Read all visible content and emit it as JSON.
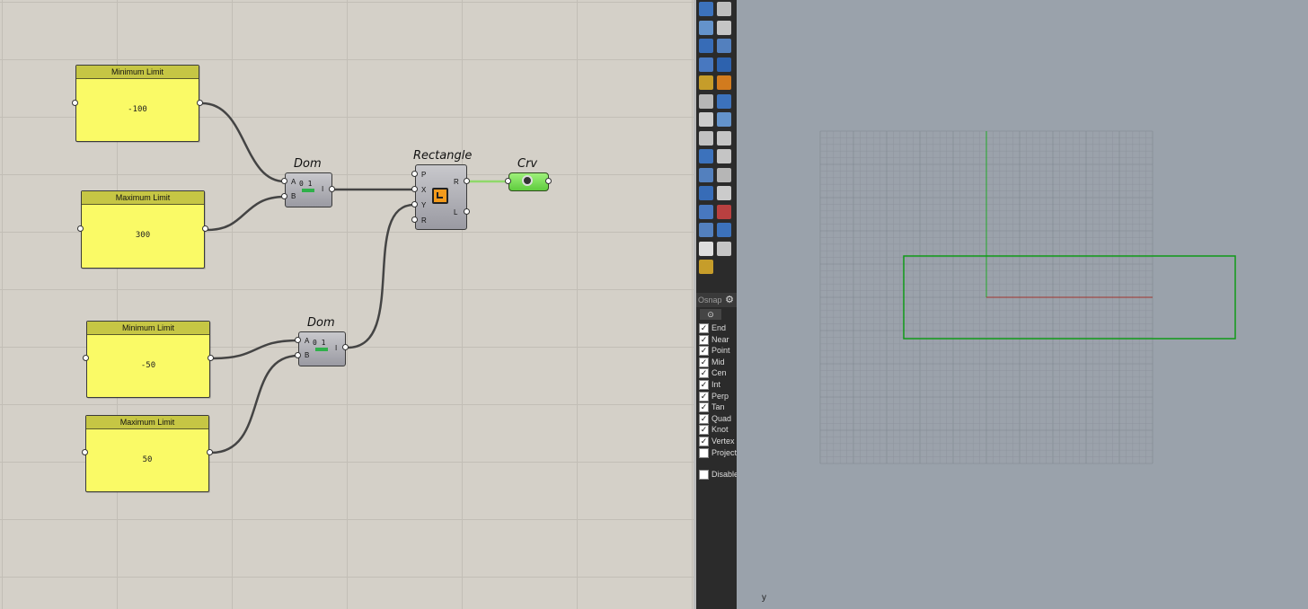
{
  "definition": {
    "sliders": [
      {
        "title": "Minimum Limit",
        "value": "-100"
      },
      {
        "title": "Maximum Limit",
        "value": "300"
      },
      {
        "title": "Minimum Limit",
        "value": "-50"
      },
      {
        "title": "Maximum Limit",
        "value": "50"
      }
    ],
    "dom1": {
      "title": "Dom",
      "inputs": [
        "A",
        "B"
      ],
      "outputs": [
        "I"
      ]
    },
    "dom2": {
      "title": "Dom",
      "inputs": [
        "A",
        "B"
      ],
      "outputs": [
        "I"
      ]
    },
    "rectangle": {
      "title": "Rectangle",
      "inputs": [
        "P",
        "X",
        "Y",
        "R"
      ],
      "outputs": [
        "R",
        "L"
      ]
    },
    "crv": {
      "title": "Crv"
    },
    "domain_icon_text": "0 1"
  },
  "toolbar": {
    "icons": [
      "point-icon",
      "curve-icon",
      "polyline-icon",
      "arc-icon",
      "box-icon",
      "sphere-icon",
      "surface-icon",
      "extrude-icon",
      "explode-icon",
      "transform-icon",
      "split-icon",
      "trim-icon",
      "join-icon",
      "group-icon",
      "fillet-icon",
      "offset-icon",
      "text-icon",
      "dimension-icon",
      "array-icon",
      "mirror-icon",
      "cube-icon",
      "render-icon",
      "grid-icon",
      "layout-icon",
      "analyze-icon",
      "mesh-icon",
      "check-icon",
      "shade-icon",
      "pencil-icon"
    ],
    "osnap": {
      "title": "Osnap",
      "tab_icon": "⊙",
      "items": [
        {
          "label": "End",
          "checked": true
        },
        {
          "label": "Near",
          "checked": true
        },
        {
          "label": "Point",
          "checked": true
        },
        {
          "label": "Mid",
          "checked": true
        },
        {
          "label": "Cen",
          "checked": true
        },
        {
          "label": "Int",
          "checked": true
        },
        {
          "label": "Perp",
          "checked": true
        },
        {
          "label": "Tan",
          "checked": true
        },
        {
          "label": "Quad",
          "checked": true
        },
        {
          "label": "Knot",
          "checked": true
        },
        {
          "label": "Vertex",
          "checked": true
        },
        {
          "label": "Project",
          "checked": false
        }
      ],
      "disable": {
        "label": "Disable",
        "checked": false
      }
    }
  },
  "viewport": {
    "axis_label": "y",
    "colors": {
      "background": "#9aa2ab",
      "grid": "#8c939c",
      "rectangle": "#0f9a18",
      "x_axis": "#a0342c",
      "y_axis": "#22a82a"
    }
  }
}
